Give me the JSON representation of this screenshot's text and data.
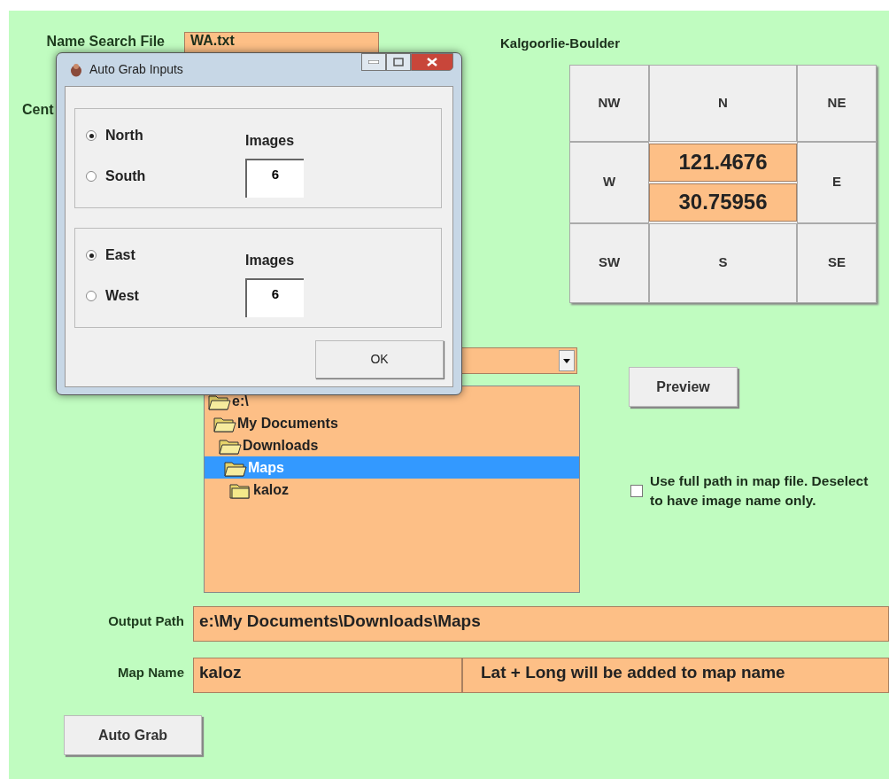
{
  "main": {
    "name_search_file": {
      "label": "Name Search File",
      "value": "WA.txt"
    },
    "center_label": "Cent",
    "location": "Kalgoorlie-Boulder",
    "direction_grid": {
      "buttons": [
        "NW",
        "N",
        "NE",
        "W",
        "E",
        "SW",
        "S",
        "SE"
      ],
      "longitude": "121.4676",
      "latitude": "30.75956"
    },
    "output_directory": {
      "tree": [
        {
          "label": "e:\\",
          "selected": false,
          "children": [
            {
              "label": "My Documents",
              "selected": false,
              "children": [
                {
                  "label": "Downloads",
                  "selected": false,
                  "children": [
                    {
                      "label": "Maps",
                      "selected": true,
                      "children": [
                        {
                          "label": "kaloz",
                          "selected": false
                        }
                      ]
                    }
                  ]
                }
              ]
            }
          ]
        }
      ]
    },
    "preview_button": "Preview",
    "full_path_checkbox": {
      "label": "Use full path in map file. Deselect to have image name only.",
      "checked": false
    },
    "output_path": {
      "label": "Output Path",
      "value": "e:\\My Documents\\Downloads\\Maps"
    },
    "map_name": {
      "label": "Map Name",
      "value": "kaloz",
      "note": "Lat + Long will be added to map name"
    },
    "auto_grab_button": "Auto Grab"
  },
  "dialog": {
    "title": "Auto Grab Inputs",
    "groups": [
      {
        "options": [
          {
            "label": "North",
            "selected": true
          },
          {
            "label": "South",
            "selected": false
          }
        ],
        "images_label": "Images",
        "images_value": "6"
      },
      {
        "options": [
          {
            "label": "East",
            "selected": true
          },
          {
            "label": "West",
            "selected": false
          }
        ],
        "images_label": "Images",
        "images_value": "6"
      }
    ],
    "ok_button": "OK"
  }
}
